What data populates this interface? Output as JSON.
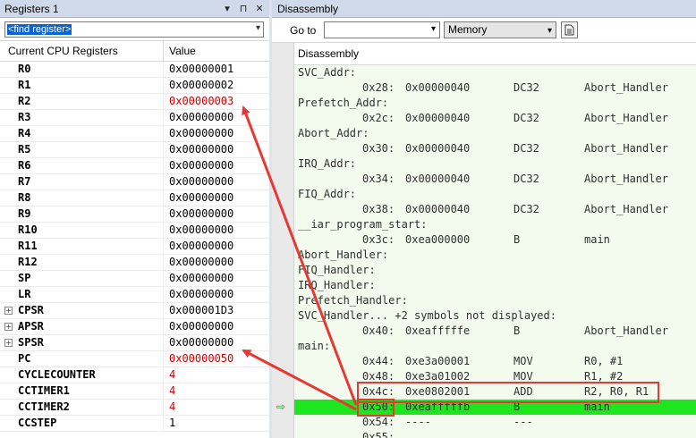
{
  "registers_panel": {
    "title": "Registers 1",
    "title_buttons": [
      "▾",
      "⊓",
      "✕"
    ],
    "find_register": "<find register>",
    "columns": [
      "Current CPU Registers",
      "Value"
    ],
    "rows": [
      {
        "name": "R0",
        "value": "0x00000001",
        "changed": false,
        "expandable": false
      },
      {
        "name": "R1",
        "value": "0x00000002",
        "changed": false,
        "expandable": false
      },
      {
        "name": "R2",
        "value": "0x00000003",
        "changed": true,
        "expandable": false
      },
      {
        "name": "R3",
        "value": "0x00000000",
        "changed": false,
        "expandable": false
      },
      {
        "name": "R4",
        "value": "0x00000000",
        "changed": false,
        "expandable": false
      },
      {
        "name": "R5",
        "value": "0x00000000",
        "changed": false,
        "expandable": false
      },
      {
        "name": "R6",
        "value": "0x00000000",
        "changed": false,
        "expandable": false
      },
      {
        "name": "R7",
        "value": "0x00000000",
        "changed": false,
        "expandable": false
      },
      {
        "name": "R8",
        "value": "0x00000000",
        "changed": false,
        "expandable": false
      },
      {
        "name": "R9",
        "value": "0x00000000",
        "changed": false,
        "expandable": false
      },
      {
        "name": "R10",
        "value": "0x00000000",
        "changed": false,
        "expandable": false
      },
      {
        "name": "R11",
        "value": "0x00000000",
        "changed": false,
        "expandable": false
      },
      {
        "name": "R12",
        "value": "0x00000000",
        "changed": false,
        "expandable": false
      },
      {
        "name": "SP",
        "value": "0x00000000",
        "changed": false,
        "expandable": false
      },
      {
        "name": "LR",
        "value": "0x00000000",
        "changed": false,
        "expandable": false
      },
      {
        "name": "CPSR",
        "value": "0x000001D3",
        "changed": false,
        "expandable": true
      },
      {
        "name": "APSR",
        "value": "0x00000000",
        "changed": false,
        "expandable": true
      },
      {
        "name": "SPSR",
        "value": "0x00000000",
        "changed": false,
        "expandable": true
      },
      {
        "name": "PC",
        "value": "0x00000050",
        "changed": true,
        "expandable": false
      },
      {
        "name": "CYCLECOUNTER",
        "value": "4",
        "changed": true,
        "expandable": false
      },
      {
        "name": "CCTIMER1",
        "value": "4",
        "changed": true,
        "expandable": false
      },
      {
        "name": "CCTIMER2",
        "value": "4",
        "changed": true,
        "expandable": false
      },
      {
        "name": "CCSTEP",
        "value": "1",
        "changed": false,
        "expandable": false
      }
    ]
  },
  "disassembly_panel": {
    "title": "Disassembly",
    "goto_label": "Go to",
    "goto_value": "",
    "memory_select": "Memory",
    "list_header": "Disassembly",
    "lines": [
      {
        "kind": "label",
        "text": "SVC_Addr:"
      },
      {
        "kind": "instr",
        "addr": "0x28:",
        "code": "0x00000040",
        "mnemonic": "DC32",
        "operands": "Abort_Handler"
      },
      {
        "kind": "label",
        "text": "Prefetch_Addr:"
      },
      {
        "kind": "instr",
        "addr": "0x2c:",
        "code": "0x00000040",
        "mnemonic": "DC32",
        "operands": "Abort_Handler"
      },
      {
        "kind": "label",
        "text": "Abort_Addr:"
      },
      {
        "kind": "instr",
        "addr": "0x30:",
        "code": "0x00000040",
        "mnemonic": "DC32",
        "operands": "Abort_Handler"
      },
      {
        "kind": "label",
        "text": "IRQ_Addr:"
      },
      {
        "kind": "instr",
        "addr": "0x34:",
        "code": "0x00000040",
        "mnemonic": "DC32",
        "operands": "Abort_Handler"
      },
      {
        "kind": "label",
        "text": "FIQ_Addr:"
      },
      {
        "kind": "instr",
        "addr": "0x38:",
        "code": "0x00000040",
        "mnemonic": "DC32",
        "operands": "Abort_Handler"
      },
      {
        "kind": "label",
        "text": "__iar_program_start:"
      },
      {
        "kind": "instr",
        "addr": "0x3c:",
        "code": "0xea000000",
        "mnemonic": "B",
        "operands": "main"
      },
      {
        "kind": "label",
        "text": "Abort_Handler:"
      },
      {
        "kind": "label",
        "text": "FIQ_Handler:"
      },
      {
        "kind": "label",
        "text": "IRQ_Handler:"
      },
      {
        "kind": "label",
        "text": "Prefetch_Handler:"
      },
      {
        "kind": "label",
        "text": "SVC_Handler... +2 symbols not displayed:"
      },
      {
        "kind": "instr",
        "addr": "0x40:",
        "code": "0xeafffffe",
        "mnemonic": "B",
        "operands": "Abort_Handler"
      },
      {
        "kind": "label",
        "text": "main:"
      },
      {
        "kind": "instr",
        "addr": "0x44:",
        "code": "0xe3a00001",
        "mnemonic": "MOV",
        "operands": "R0, #1"
      },
      {
        "kind": "instr",
        "addr": "0x48:",
        "code": "0xe3a01002",
        "mnemonic": "MOV",
        "operands": "R1, #2"
      },
      {
        "kind": "instr",
        "addr": "0x4c:",
        "code": "0xe0802001",
        "mnemonic": "ADD",
        "operands": "R2, R0, R1"
      },
      {
        "kind": "instr",
        "addr": "0x50:",
        "code": "0xeafffffb",
        "mnemonic": "B",
        "operands": "main",
        "current": true
      },
      {
        "kind": "instr",
        "addr": "0x54:",
        "code": "----",
        "mnemonic": "---",
        "operands": ""
      },
      {
        "kind": "instr",
        "addr": "0x55:",
        "code": "",
        "mnemonic": "",
        "operands": ""
      }
    ]
  },
  "colors": {
    "changed_value": "#d00000",
    "current_line": "#1ee61e",
    "annotation": "#e53935",
    "disassembly_bg": "#f3fbee",
    "title_bar": "#cfd9ea"
  }
}
